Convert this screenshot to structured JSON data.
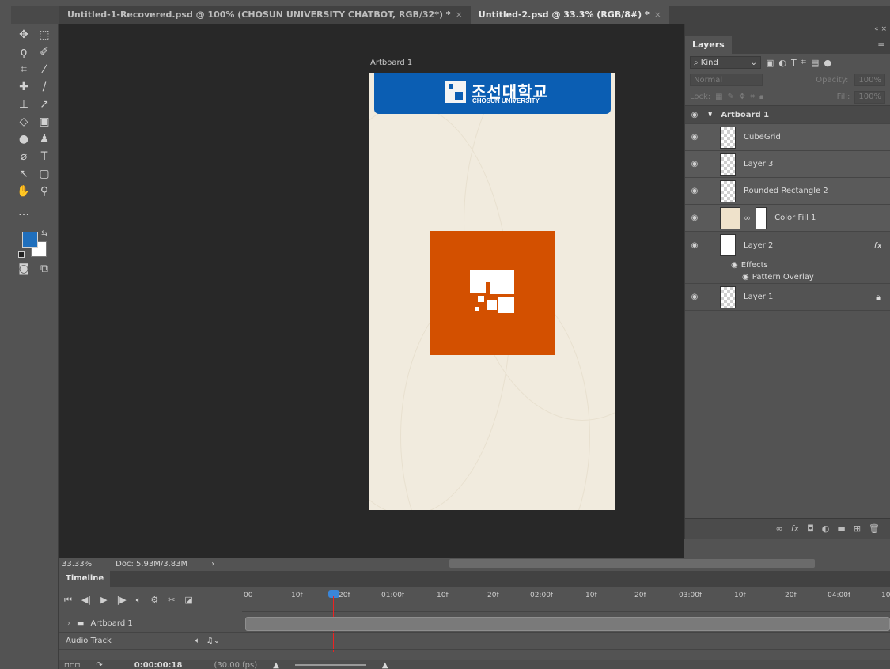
{
  "tabs": [
    {
      "label": "Untitled-1-Recovered.psd @ 100% (CHOSUN UNIVERSITY CHATBOT, RGB/32*) *",
      "close": "×"
    },
    {
      "label": "Untitled-2.psd @ 33.3% (RGB/8#) *",
      "close": "×"
    }
  ],
  "colors": {
    "foreground": "#1f6fbd",
    "background": "#ffffff",
    "header_blue": "#0b5eb3",
    "logo_orange": "#d35000",
    "artboard_bg": "#f1ebde"
  },
  "canvas": {
    "artboard_label": "Artboard 1",
    "logo_korean": "조선대학교",
    "logo_english": "CHOSUN UNIVERSITY"
  },
  "layers_panel": {
    "title": "Layers",
    "filter_kind": "Kind",
    "blend_mode": "Normal",
    "opacity_label": "Opacity:",
    "opacity_value": "100%",
    "lock_label": "Lock:",
    "fill_label": "Fill:",
    "fill_value": "100%",
    "group_name": "Artboard 1",
    "layers": [
      {
        "name": "CubeGrid"
      },
      {
        "name": "Layer 3"
      },
      {
        "name": "Rounded Rectangle 2"
      },
      {
        "name": "Color Fill 1"
      },
      {
        "name": "Layer 2",
        "fx": "fx"
      },
      {
        "name": "Layer 1"
      }
    ],
    "effects_label": "Effects",
    "effect_item": "Pattern Overlay"
  },
  "status": {
    "zoom": "33.33%",
    "doc": "Doc: 5.93M/3.83M"
  },
  "timeline": {
    "title": "Timeline",
    "ruler_labels": [
      "00",
      "10f",
      "20f",
      "01:00f",
      "10f",
      "20f",
      "02:00f",
      "10f",
      "20f",
      "03:00f",
      "10f",
      "20f",
      "04:00f",
      "10"
    ],
    "tracks": [
      {
        "name": "Artboard 1"
      },
      {
        "name": "Audio Track"
      }
    ],
    "timecode": "0:00:00:18",
    "fps": "(30.00 fps)"
  }
}
